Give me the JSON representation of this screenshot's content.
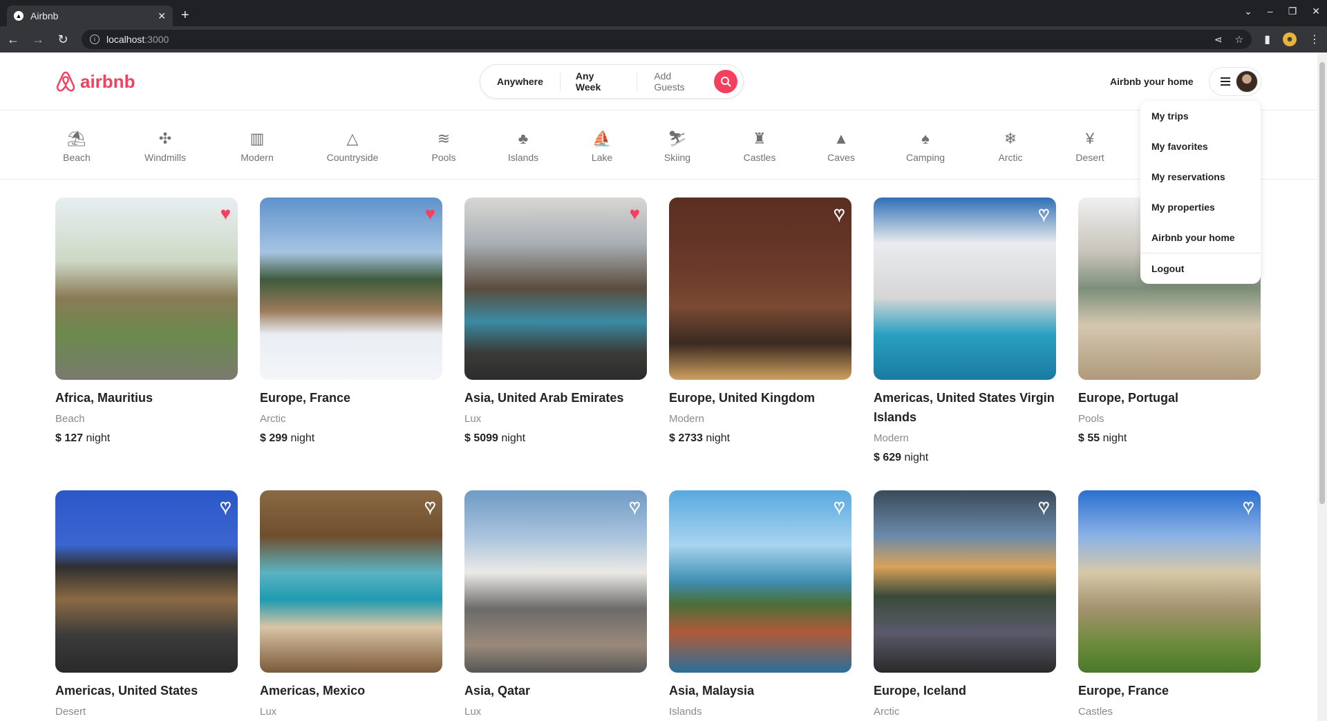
{
  "browser": {
    "tab_title": "Airbnb",
    "url_host": "localhost",
    "url_port": ":3000"
  },
  "header": {
    "logo_text": "airbnb",
    "search": {
      "anywhere": "Anywhere",
      "any_week": "Any Week",
      "add_guests": "Add Guests"
    },
    "host_link": "Airbnb your home"
  },
  "menu": {
    "items": [
      "My trips",
      "My favorites",
      "My reservations",
      "My properties",
      "Airbnb your home",
      "Logout"
    ]
  },
  "categories": [
    {
      "label": "Beach",
      "icon": "beach-icon",
      "glyph": "⛱"
    },
    {
      "label": "Windmills",
      "icon": "windmill-icon",
      "glyph": "✣"
    },
    {
      "label": "Modern",
      "icon": "modern-icon",
      "glyph": "▥"
    },
    {
      "label": "Countryside",
      "icon": "countryside-icon",
      "glyph": "△"
    },
    {
      "label": "Pools",
      "icon": "pool-icon",
      "glyph": "≋"
    },
    {
      "label": "Islands",
      "icon": "island-icon",
      "glyph": "♣"
    },
    {
      "label": "Lake",
      "icon": "lake-icon",
      "glyph": "⛵"
    },
    {
      "label": "Skiing",
      "icon": "skiing-icon",
      "glyph": "⛷"
    },
    {
      "label": "Castles",
      "icon": "castle-icon",
      "glyph": "♜"
    },
    {
      "label": "Caves",
      "icon": "cave-icon",
      "glyph": "▲"
    },
    {
      "label": "Camping",
      "icon": "camping-icon",
      "glyph": "♠"
    },
    {
      "label": "Arctic",
      "icon": "snowflake-icon",
      "glyph": "❄"
    },
    {
      "label": "Desert",
      "icon": "cactus-icon",
      "glyph": "¥"
    }
  ],
  "listings": [
    {
      "location": "Africa, Mauritius",
      "category": "Beach",
      "price": "$ 127",
      "unit": "night",
      "favorite": true,
      "bg": "linear-gradient(180deg,#e8eef2 0%,#cdd8c4 35%,#8a7b58 55%,#6b8a4d 75%,#7a7a6e 100%)"
    },
    {
      "location": "Europe, France",
      "category": "Arctic",
      "price": "$ 299",
      "unit": "night",
      "favorite": true,
      "bg": "linear-gradient(180deg,#5f92cc 0%,#a6c4e2 30%,#3f5b3d 45%,#9a7a5a 62%,#e9eef3 75%,#f4f6f9 100%)"
    },
    {
      "location": "Asia, United Arab Emirates",
      "category": "Lux",
      "price": "$ 5099",
      "unit": "night",
      "favorite": true,
      "bg": "linear-gradient(180deg,#d9d6d4 0%,#a9b0b4 25%,#5b4c3e 50%,#3a8aa3 68%,#3b3b38 85%,#2c2c2c 100%)"
    },
    {
      "location": "Europe, United Kingdom",
      "category": "Modern",
      "price": "$ 2733",
      "unit": "night",
      "favorite": false,
      "bg": "linear-gradient(180deg,#5a2e22 0%,#6b3a2a 40%,#7a4a33 60%,#3a2a20 80%,#d0a060 100%)"
    },
    {
      "location": "Americas, United States Virgin Islands",
      "category": "Modern",
      "price": "$ 629",
      "unit": "night",
      "favorite": false,
      "bg": "linear-gradient(180deg,#2f6fb6 0%,#e9ebee 25%,#d6d6d6 55%,#2aa0c2 75%,#1a7aa0 100%)"
    },
    {
      "location": "Europe, Portugal",
      "category": "Pools",
      "price": "$ 55",
      "unit": "night",
      "favorite": false,
      "bg": "linear-gradient(180deg,#f0f0f0 0%,#c8c4bb 30%,#7c8f7a 50%,#d5c7b0 70%,#b09a7a 100%)"
    },
    {
      "location": "Americas, United States",
      "category": "Desert",
      "price": "",
      "unit": "",
      "favorite": false,
      "bg": "linear-gradient(180deg,#2c57c8 0%,#3b66d0 30%,#2f2f2f 42%,#8a6a44 60%,#3a3a3a 80%,#2a2a2a 100%)"
    },
    {
      "location": "Americas, Mexico",
      "category": "Lux",
      "price": "",
      "unit": "",
      "favorite": false,
      "bg": "linear-gradient(180deg,#8a6a44 0%,#6f4e2e 25%,#5bb3c2 45%,#1f9ab0 60%,#d9c4a5 75%,#7a5a3a 100%)"
    },
    {
      "location": "Asia, Qatar",
      "category": "Lux",
      "price": "",
      "unit": "",
      "favorite": false,
      "bg": "linear-gradient(180deg,#6f9bc4 0%,#a8c2dc 25%,#eceae6 45%,#6b6b6b 65%,#9a8a7a 85%,#555 100%)"
    },
    {
      "location": "Asia, Malaysia",
      "category": "Islands",
      "price": "",
      "unit": "",
      "favorite": false,
      "bg": "linear-gradient(180deg,#58a9e0 0%,#a8d4ef 30%,#3f8fb2 50%,#4a6f3a 62%,#b05a3a 78%,#2a6f9a 100%)"
    },
    {
      "location": "Europe, Iceland",
      "category": "Arctic",
      "price": "",
      "unit": "",
      "favorite": false,
      "bg": "linear-gradient(180deg,#3a4a5a 0%,#6a8aaa 25%,#d9a25a 42%,#3a4a3a 58%,#5a5a6a 78%,#2a2a2a 100%)"
    },
    {
      "location": "Europe, France",
      "category": "Castles",
      "price": "",
      "unit": "",
      "favorite": false,
      "bg": "linear-gradient(180deg,#2a6fd0 0%,#8ab2e6 25%,#d6c8a8 45%,#a4926e 65%,#6a8a3a 85%,#4a7a2a 100%)"
    }
  ]
}
